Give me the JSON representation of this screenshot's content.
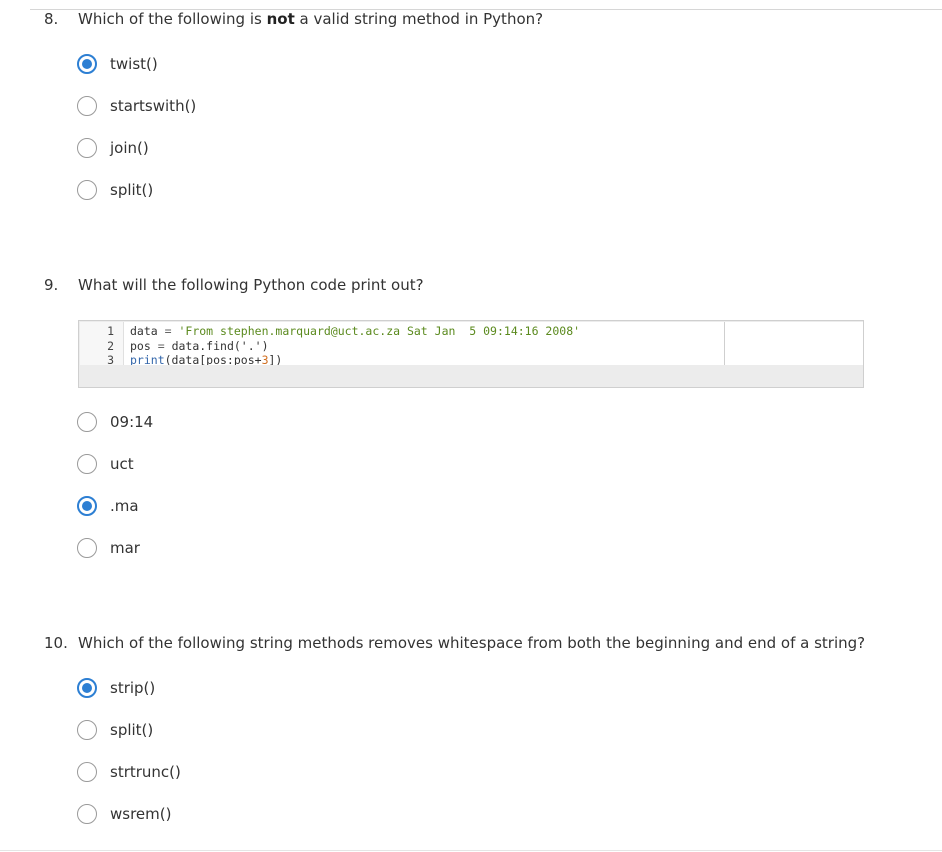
{
  "colors": {
    "accent": "#2d7fd3",
    "string": "#5b8a1e",
    "number": "#d06d1e",
    "keyword": "#3366aa"
  },
  "questions": [
    {
      "number": "8.",
      "text_before": "Which of the following is ",
      "text_bold": "not",
      "text_after": " a valid string method in Python?",
      "options": [
        {
          "label": "twist()",
          "selected": true
        },
        {
          "label": "startswith()",
          "selected": false
        },
        {
          "label": "join()",
          "selected": false
        },
        {
          "label": "split()",
          "selected": false
        }
      ]
    },
    {
      "number": "9.",
      "text": "What will the following Python code print out?",
      "code": {
        "line_numbers": [
          "1",
          "2",
          "3"
        ],
        "line1": {
          "var": "data",
          "op": " = ",
          "str": "'From stephen.marquard@uct.ac.za Sat Jan  5 09:14:16 2008'"
        },
        "line2": {
          "var": "pos",
          "op": " = ",
          "rest": "data.find('.')"
        },
        "line3": {
          "kw": "print",
          "mid": "(data[pos:pos+",
          "num": "3",
          "end": "])"
        }
      },
      "options": [
        {
          "label": "09:14",
          "selected": false
        },
        {
          "label": "uct",
          "selected": false
        },
        {
          "label": ".ma",
          "selected": true
        },
        {
          "label": "mar",
          "selected": false
        }
      ]
    },
    {
      "number": "10.",
      "text": "Which of the following string methods removes whitespace from both the beginning and end of a string?",
      "options": [
        {
          "label": "strip()",
          "selected": true
        },
        {
          "label": "split()",
          "selected": false
        },
        {
          "label": "strtrunc()",
          "selected": false
        },
        {
          "label": "wsrem()",
          "selected": false
        }
      ]
    }
  ]
}
